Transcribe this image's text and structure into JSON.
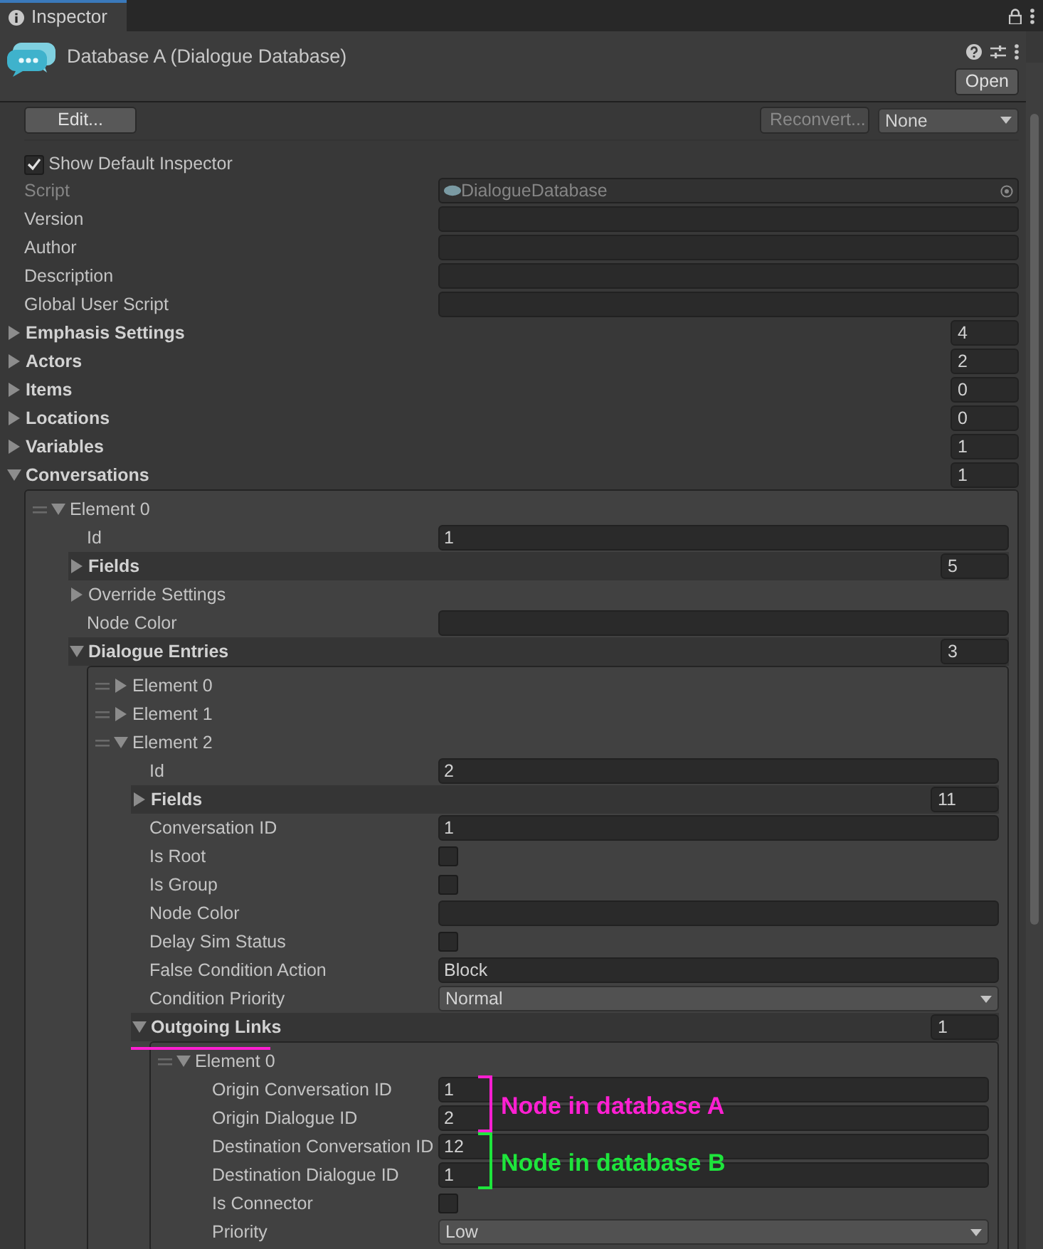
{
  "tab": {
    "title": "Inspector",
    "selected": true
  },
  "header": {
    "title": "Database A (Dialogue Database)",
    "open_button": "Open"
  },
  "toolbar": {
    "edit_button": "Edit...",
    "reconvert_button": "Reconvert...",
    "reconvert_disabled": true,
    "format_dropdown": "None"
  },
  "show_default_inspector": {
    "label": "Show Default Inspector",
    "checked": true
  },
  "properties": [
    {
      "kind": "object",
      "label": "Script",
      "value": "DialogueDatabase",
      "disabled": true
    },
    {
      "kind": "text",
      "label": "Version"
    },
    {
      "kind": "text",
      "label": "Author"
    },
    {
      "kind": "text",
      "label": "Description"
    },
    {
      "kind": "text",
      "label": "Global User Script"
    },
    {
      "kind": "array",
      "label": "Emphasis Settings",
      "count": "4",
      "expanded": false
    },
    {
      "kind": "array",
      "label": "Actors",
      "count": "2",
      "expanded": false
    },
    {
      "kind": "array",
      "label": "Items",
      "count": "0",
      "expanded": false
    },
    {
      "kind": "array",
      "label": "Locations",
      "count": "0",
      "expanded": false
    },
    {
      "kind": "array",
      "label": "Variables",
      "count": "1",
      "expanded": false
    },
    {
      "kind": "array",
      "label": "Conversations",
      "count": "1",
      "expanded": true,
      "children": [
        {
          "kind": "element",
          "label": "Element 0",
          "expanded": true,
          "children": [
            {
              "kind": "text",
              "label": "Id",
              "value": "1"
            },
            {
              "kind": "array",
              "label": "Fields",
              "count": "5",
              "expanded": false
            },
            {
              "kind": "foldout",
              "label": "Override Settings",
              "expanded": false
            },
            {
              "kind": "text",
              "label": "Node Color"
            },
            {
              "kind": "array",
              "label": "Dialogue Entries",
              "count": "3",
              "expanded": true,
              "children": [
                {
                  "kind": "element",
                  "label": "Element 0",
                  "expanded": false
                },
                {
                  "kind": "element",
                  "label": "Element 1",
                  "expanded": false
                },
                {
                  "kind": "element",
                  "label": "Element 2",
                  "expanded": true,
                  "children": [
                    {
                      "kind": "text",
                      "label": "Id",
                      "value": "2"
                    },
                    {
                      "kind": "array",
                      "label": "Fields",
                      "count": "11",
                      "expanded": false
                    },
                    {
                      "kind": "text",
                      "label": "Conversation ID",
                      "value": "1"
                    },
                    {
                      "kind": "toggle",
                      "label": "Is Root",
                      "checked": false
                    },
                    {
                      "kind": "toggle",
                      "label": "Is Group",
                      "checked": false
                    },
                    {
                      "kind": "text",
                      "label": "Node Color"
                    },
                    {
                      "kind": "toggle",
                      "label": "Delay Sim Status",
                      "checked": false
                    },
                    {
                      "kind": "text",
                      "label": "False Condition Action",
                      "value": "Block"
                    },
                    {
                      "kind": "enum",
                      "label": "Condition Priority",
                      "value": "Normal"
                    },
                    {
                      "kind": "array",
                      "label": "Outgoing Links",
                      "count": "1",
                      "expanded": true,
                      "underlined": true,
                      "children": [
                        {
                          "kind": "element",
                          "label": "Element 0",
                          "expanded": true,
                          "children": [
                            {
                              "kind": "text",
                              "label": "Origin Conversation ID",
                              "value": "1"
                            },
                            {
                              "kind": "text",
                              "label": "Origin Dialogue ID",
                              "value": "2"
                            },
                            {
                              "kind": "text",
                              "label": "Destination Conversation ID",
                              "value": "12"
                            },
                            {
                              "kind": "text",
                              "label": "Destination Dialogue ID",
                              "value": "1"
                            },
                            {
                              "kind": "toggle",
                              "label": "Is Connector",
                              "checked": false
                            },
                            {
                              "kind": "enum",
                              "label": "Priority",
                              "value": "Low"
                            }
                          ]
                        }
                      ]
                    }
                  ]
                }
              ]
            }
          ]
        }
      ]
    }
  ],
  "annotations": [
    {
      "text": "Node in database A",
      "color": "#ff1fd2"
    },
    {
      "text": "Node in database B",
      "color": "#1ee53c"
    }
  ]
}
